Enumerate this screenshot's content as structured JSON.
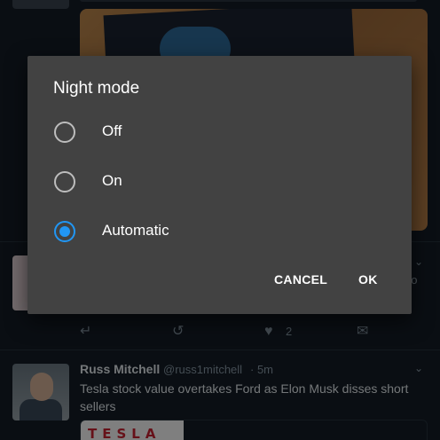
{
  "dialog": {
    "title": "Night mode",
    "options": [
      {
        "label": "Off",
        "selected": false
      },
      {
        "label": "On",
        "selected": false
      },
      {
        "label": "Automatic",
        "selected": true
      }
    ],
    "cancel_label": "CANCEL",
    "ok_label": "OK",
    "accent_color": "#2196f3"
  },
  "timeline": {
    "tweet_partial": {
      "trailing_text": "oo",
      "like_count": "2",
      "icons": [
        "reply-icon",
        "retweet-icon",
        "like-icon",
        "direct-message-icon"
      ]
    },
    "tweet": {
      "name": "Russ Mitchell",
      "handle": "@russ1mitchell",
      "time": "· 5m",
      "text": "Tesla stock value overtakes Ford as Elon Musk disses short sellers",
      "card_brand": "TESLA"
    }
  }
}
